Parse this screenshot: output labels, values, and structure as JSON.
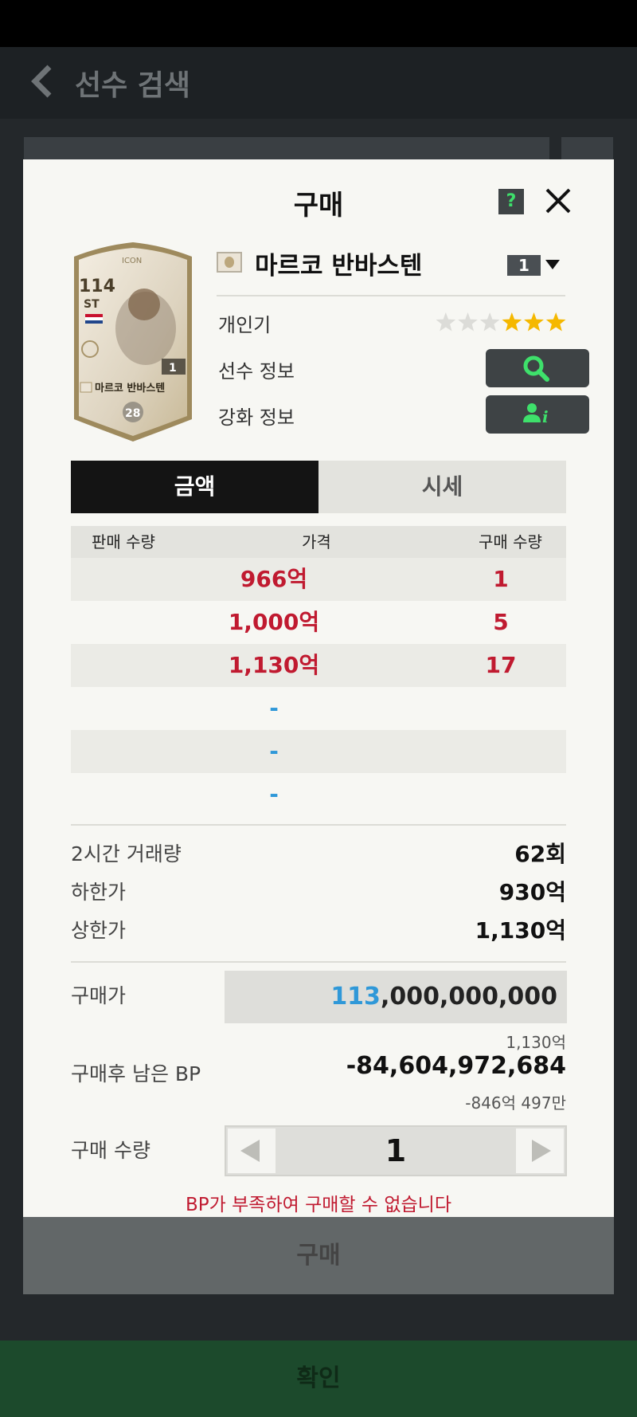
{
  "background": {
    "title": "선수 검색"
  },
  "modal": {
    "title": "구매",
    "help_label": "?",
    "player": {
      "name": "마르코 반바스텐",
      "grade": "1",
      "card": {
        "rating": "114",
        "position": "ST",
        "tag": "ICON",
        "grade_badge": "1",
        "name": "마르코 반바스텐",
        "salary": "28"
      },
      "popularity_label": "개인기",
      "popularity_stars": 3,
      "popularity_max": 6,
      "info_label": "선수 정보",
      "upgrade_label": "강화 정보"
    },
    "tabs": [
      {
        "label": "금액",
        "active": true
      },
      {
        "label": "시세",
        "active": false
      }
    ],
    "table": {
      "headers": [
        "판매 수량",
        "가격",
        "구매 수량"
      ],
      "rows": [
        {
          "price": "966억",
          "qty": "1"
        },
        {
          "price": "1,000억",
          "qty": "5"
        },
        {
          "price": "1,130억",
          "qty": "17"
        },
        {
          "price": "-",
          "qty": ""
        },
        {
          "price": "-",
          "qty": ""
        },
        {
          "price": "-",
          "qty": ""
        }
      ]
    },
    "stats": {
      "volume_label": "2시간 거래량",
      "volume_value": "62회",
      "min_label": "하한가",
      "min_value": "930억",
      "max_label": "상한가",
      "max_value": "1,130억"
    },
    "purchase": {
      "price_label": "구매가",
      "price_highlight": "113",
      "price_rest": ",000,000,000",
      "price_note": "1,130억",
      "remain_label": "구매후 남은 BP",
      "remain_value": "-84,604,972,684",
      "remain_note": "-846억 497만",
      "qty_label": "구매 수량",
      "qty_value": "1",
      "warning": "BP가 부족하여 구매할 수 없습니다"
    },
    "buy_label": "구매"
  },
  "confirm_label": "확인",
  "colors": {
    "price_red": "#c01a30",
    "accent_blue": "#2f98d8",
    "action_green": "#3ee06b"
  }
}
